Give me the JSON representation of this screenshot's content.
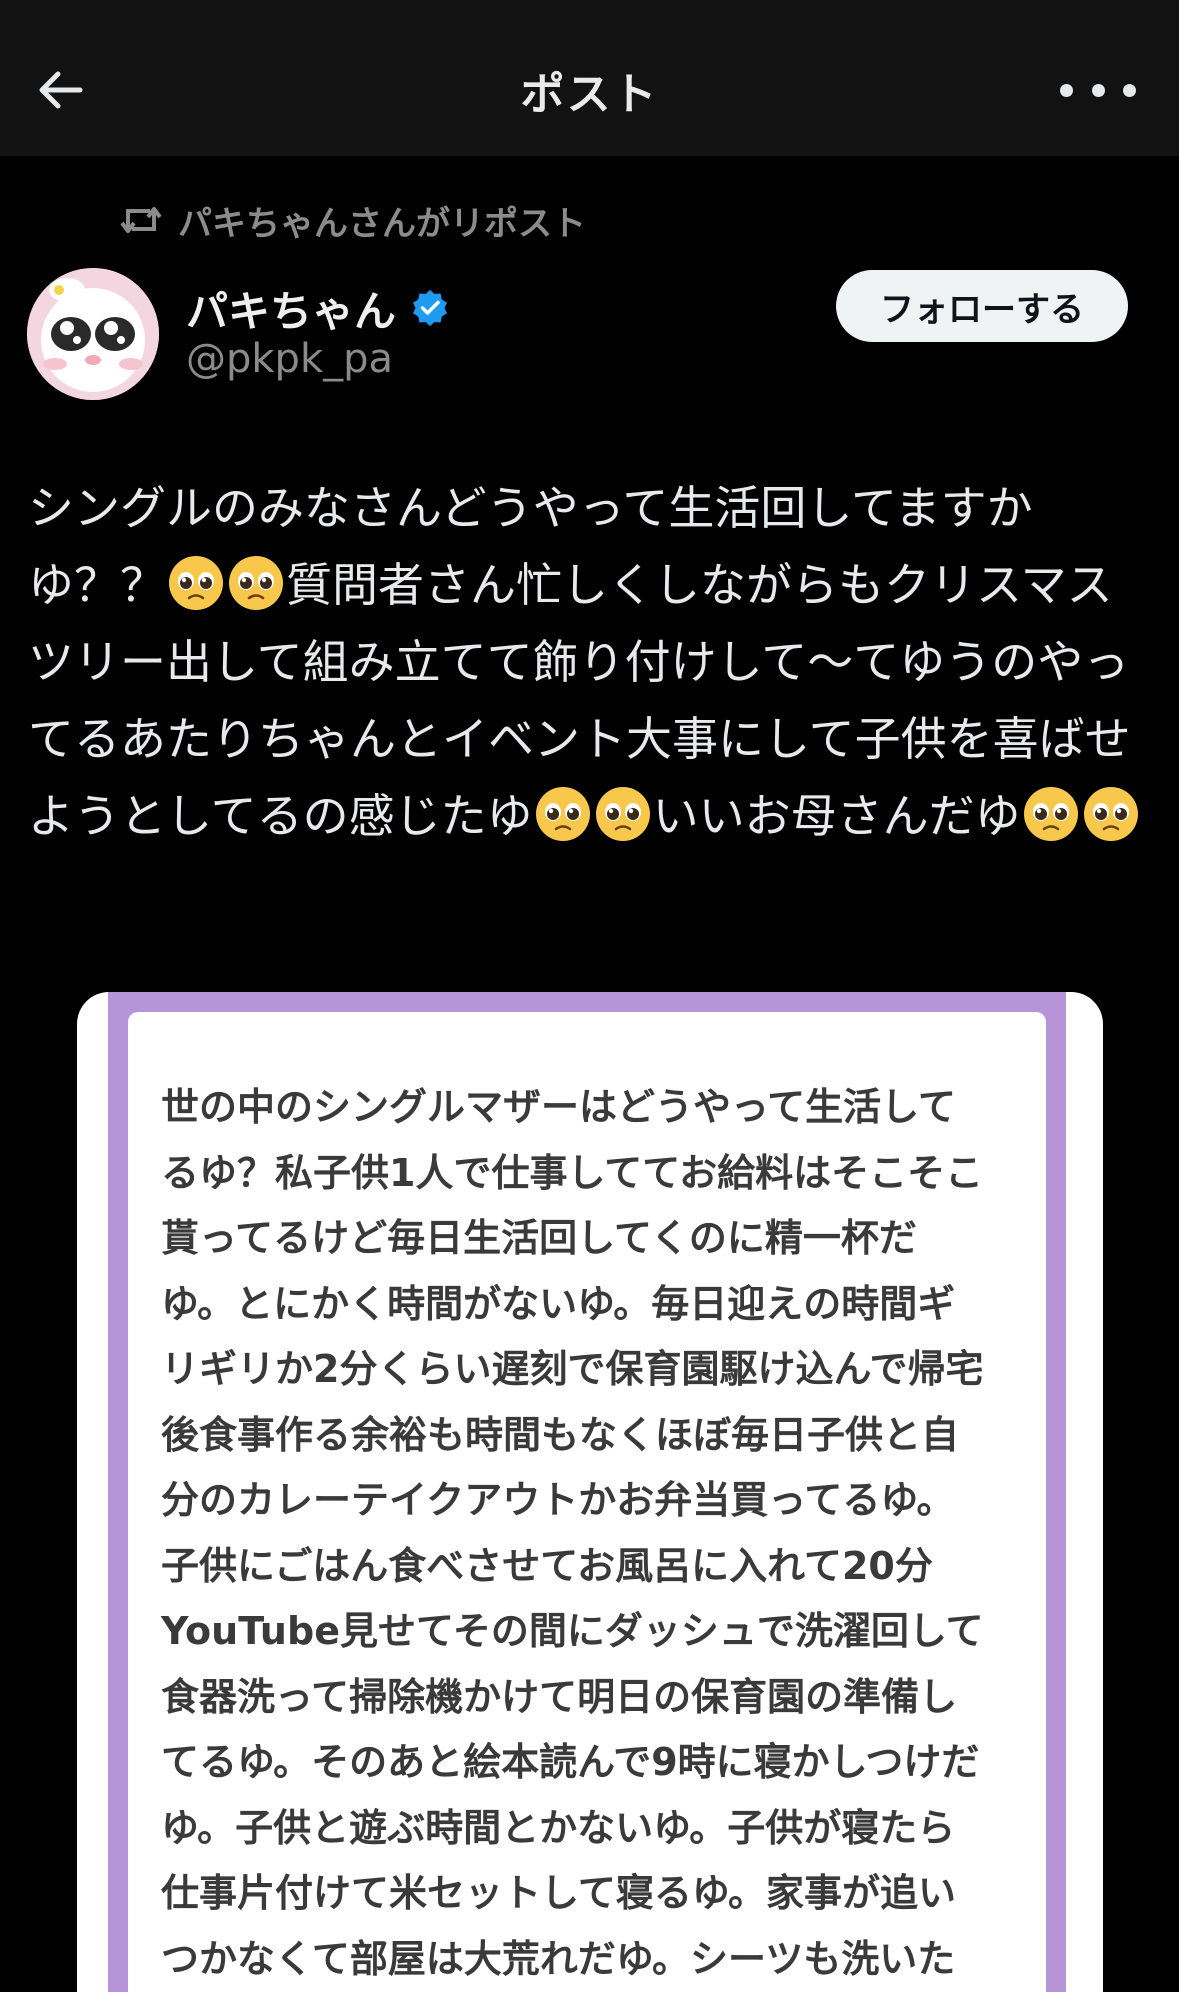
{
  "header": {
    "title": "ポスト",
    "back_icon": "arrow-left-icon",
    "more_icon": "more-horizontal-icon"
  },
  "repost": {
    "label": "パキちゃんさんがリポスト",
    "icon": "repost-icon"
  },
  "author": {
    "display_name": "パキちゃん",
    "handle": "@pkpk_pa",
    "verified": true,
    "verified_color": "#1d9bf0"
  },
  "follow_button": {
    "label": "フォローする"
  },
  "post": {
    "segments": [
      "シングルのみなさんどうやって生活回してますかゆ？？",
      "質問者さん忙しくしながらもクリスマスツリー出して組み立てて飾り付けして〜てゆうのやってるあたりちゃんとイベント大事にして子供を喜ばせようとしてるの感じたゆ",
      "いいお母さんだゆ"
    ],
    "emoji": "pleading-face-emoji"
  },
  "attached_image": {
    "frame_color": "#b793d8",
    "lines": [
      "世の中のシングルマザーはどうやって生活して",
      "るゆ？私子供1人で仕事しててお給料はそこそこ",
      "貰ってるけど毎日生活回してくのに精一杯だ",
      "ゆ。とにかく時間がないゆ。毎日迎えの時間ギ",
      "リギリか2分くらい遅刻で保育園駆け込んで帰宅",
      "後食事作る余裕も時間もなくほぼ毎日子供と自",
      "分のカレーテイクアウトかお弁当買ってるゆ。",
      "子供にごはん食べさせてお風呂に入れて20分",
      "YouTube見せてその間にダッシュで洗濯回して",
      "食器洗って掃除機かけて明日の保育園の準備し",
      "てるゆ。そのあと絵本読んで9時に寝かしつけだ",
      "ゆ。子供と遊ぶ時間とかないゆ。子供が寝たら",
      "仕事片付けて米セットして寝るゆ。家事が追い",
      "つかなくて部屋は大荒れだゆ。シーツも洗いた"
    ]
  }
}
